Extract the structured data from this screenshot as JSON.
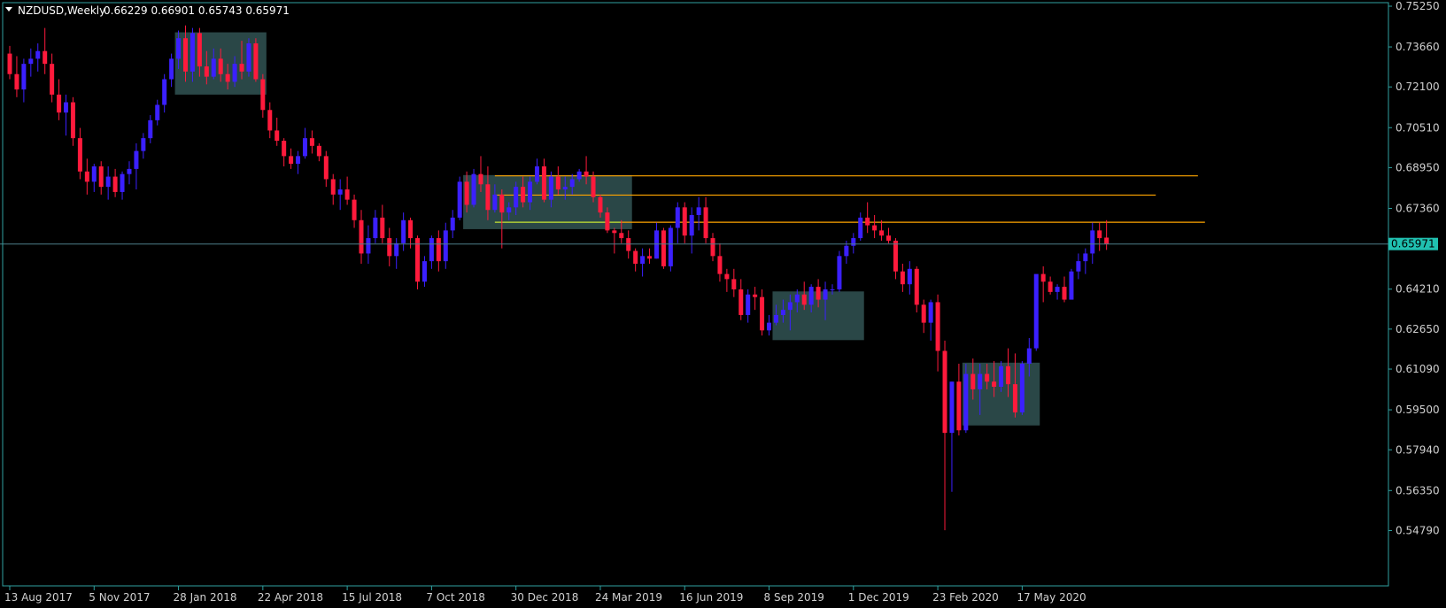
{
  "header": {
    "symbol_timeframe": "NZDUSD,Weekly",
    "ohlc": "0.66229 0.66901 0.65743 0.65971"
  },
  "colors": {
    "background": "#000000",
    "frame": "#2fa0a0",
    "bull": "#3b20ff",
    "bear": "#ff1a3c",
    "zone_fill": "#2f4f4f",
    "resistance": "#ffa500",
    "support": "#c8e632",
    "current_price_line": "#4d7f8a",
    "price_label_bg": "#20c0b0"
  },
  "chart_data": {
    "type": "candlestick",
    "title": "NZDUSD,Weekly",
    "ylim": [
      0.5415,
      0.7525
    ],
    "y_ticks": [
      "0.75250",
      "0.73660",
      "0.72100",
      "0.70510",
      "0.68950",
      "0.67360",
      "0.65971",
      "0.64210",
      "0.62650",
      "0.61090",
      "0.59500",
      "0.57940",
      "0.56350",
      "0.54790"
    ],
    "x_ticks": [
      "13 Aug 2017",
      "5 Nov 2017",
      "28 Jan 2018",
      "22 Apr 2018",
      "15 Jul 2018",
      "7 Oct 2018",
      "30 Dec 2018",
      "24 Mar 2019",
      "16 Jun 2019",
      "8 Sep 2019",
      "1 Dec 2019",
      "23 Feb 2020",
      "17 May 2020"
    ],
    "x_tick_index": [
      0,
      12,
      24,
      36,
      48,
      60,
      72,
      84,
      96,
      108,
      120,
      132,
      144
    ],
    "current_price": 0.65971,
    "current_price_label": "0.65971",
    "candles": [
      [
        0.734,
        0.737,
        0.724,
        0.726
      ],
      [
        0.726,
        0.733,
        0.717,
        0.72
      ],
      [
        0.72,
        0.732,
        0.715,
        0.73
      ],
      [
        0.73,
        0.736,
        0.725,
        0.732
      ],
      [
        0.732,
        0.738,
        0.727,
        0.735
      ],
      [
        0.735,
        0.744,
        0.726,
        0.73
      ],
      [
        0.73,
        0.734,
        0.715,
        0.718
      ],
      [
        0.718,
        0.724,
        0.708,
        0.711
      ],
      [
        0.711,
        0.718,
        0.702,
        0.715
      ],
      [
        0.715,
        0.717,
        0.698,
        0.701
      ],
      [
        0.701,
        0.705,
        0.685,
        0.688
      ],
      [
        0.688,
        0.693,
        0.679,
        0.684
      ],
      [
        0.684,
        0.691,
        0.68,
        0.69
      ],
      [
        0.69,
        0.692,
        0.679,
        0.682
      ],
      [
        0.682,
        0.69,
        0.677,
        0.686
      ],
      [
        0.686,
        0.689,
        0.678,
        0.68
      ],
      [
        0.68,
        0.688,
        0.677,
        0.687
      ],
      [
        0.687,
        0.692,
        0.683,
        0.689
      ],
      [
        0.689,
        0.699,
        0.681,
        0.696
      ],
      [
        0.696,
        0.703,
        0.693,
        0.701
      ],
      [
        0.701,
        0.71,
        0.699,
        0.708
      ],
      [
        0.708,
        0.716,
        0.706,
        0.714
      ],
      [
        0.714,
        0.726,
        0.711,
        0.724
      ],
      [
        0.724,
        0.734,
        0.721,
        0.732
      ],
      [
        0.732,
        0.743,
        0.728,
        0.74
      ],
      [
        0.74,
        0.745,
        0.723,
        0.727
      ],
      [
        0.727,
        0.744,
        0.723,
        0.742
      ],
      [
        0.742,
        0.744,
        0.725,
        0.729
      ],
      [
        0.729,
        0.735,
        0.722,
        0.725
      ],
      [
        0.725,
        0.736,
        0.724,
        0.732
      ],
      [
        0.732,
        0.736,
        0.723,
        0.726
      ],
      [
        0.726,
        0.73,
        0.72,
        0.723
      ],
      [
        0.723,
        0.733,
        0.721,
        0.73
      ],
      [
        0.73,
        0.739,
        0.724,
        0.727
      ],
      [
        0.727,
        0.74,
        0.725,
        0.738
      ],
      [
        0.738,
        0.74,
        0.723,
        0.724
      ],
      [
        0.724,
        0.726,
        0.709,
        0.712
      ],
      [
        0.712,
        0.715,
        0.701,
        0.704
      ],
      [
        0.704,
        0.709,
        0.698,
        0.7
      ],
      [
        0.7,
        0.701,
        0.69,
        0.694
      ],
      [
        0.694,
        0.697,
        0.689,
        0.691
      ],
      [
        0.691,
        0.696,
        0.687,
        0.694
      ],
      [
        0.694,
        0.705,
        0.693,
        0.701
      ],
      [
        0.701,
        0.704,
        0.695,
        0.698
      ],
      [
        0.698,
        0.699,
        0.692,
        0.694
      ],
      [
        0.694,
        0.696,
        0.682,
        0.685
      ],
      [
        0.685,
        0.687,
        0.675,
        0.679
      ],
      [
        0.679,
        0.685,
        0.673,
        0.681
      ],
      [
        0.681,
        0.686,
        0.675,
        0.677
      ],
      [
        0.677,
        0.679,
        0.666,
        0.669
      ],
      [
        0.669,
        0.673,
        0.652,
        0.656
      ],
      [
        0.656,
        0.667,
        0.652,
        0.662
      ],
      [
        0.662,
        0.673,
        0.66,
        0.67
      ],
      [
        0.67,
        0.675,
        0.66,
        0.662
      ],
      [
        0.662,
        0.666,
        0.651,
        0.655
      ],
      [
        0.655,
        0.662,
        0.65,
        0.66
      ],
      [
        0.66,
        0.672,
        0.657,
        0.669
      ],
      [
        0.669,
        0.67,
        0.658,
        0.662
      ],
      [
        0.662,
        0.663,
        0.642,
        0.645
      ],
      [
        0.645,
        0.655,
        0.643,
        0.653
      ],
      [
        0.653,
        0.663,
        0.65,
        0.662
      ],
      [
        0.662,
        0.665,
        0.649,
        0.653
      ],
      [
        0.653,
        0.668,
        0.65,
        0.665
      ],
      [
        0.665,
        0.673,
        0.662,
        0.67
      ],
      [
        0.67,
        0.686,
        0.669,
        0.684
      ],
      [
        0.684,
        0.688,
        0.672,
        0.675
      ],
      [
        0.675,
        0.689,
        0.674,
        0.687
      ],
      [
        0.687,
        0.694,
        0.68,
        0.683
      ],
      [
        0.683,
        0.69,
        0.669,
        0.673
      ],
      [
        0.673,
        0.683,
        0.672,
        0.679
      ],
      [
        0.679,
        0.681,
        0.658,
        0.672
      ],
      [
        0.672,
        0.676,
        0.669,
        0.674
      ],
      [
        0.674,
        0.684,
        0.671,
        0.682
      ],
      [
        0.682,
        0.686,
        0.674,
        0.676
      ],
      [
        0.676,
        0.686,
        0.673,
        0.684
      ],
      [
        0.684,
        0.693,
        0.683,
        0.69
      ],
      [
        0.69,
        0.693,
        0.676,
        0.677
      ],
      [
        0.677,
        0.688,
        0.674,
        0.686
      ],
      [
        0.686,
        0.69,
        0.679,
        0.681
      ],
      [
        0.681,
        0.686,
        0.677,
        0.682
      ],
      [
        0.682,
        0.687,
        0.679,
        0.685
      ],
      [
        0.685,
        0.689,
        0.684,
        0.688
      ],
      [
        0.688,
        0.694,
        0.683,
        0.686
      ],
      [
        0.686,
        0.688,
        0.676,
        0.678
      ],
      [
        0.678,
        0.679,
        0.67,
        0.672
      ],
      [
        0.672,
        0.674,
        0.664,
        0.665
      ],
      [
        0.665,
        0.666,
        0.656,
        0.664
      ],
      [
        0.664,
        0.669,
        0.66,
        0.662
      ],
      [
        0.662,
        0.665,
        0.654,
        0.657
      ],
      [
        0.657,
        0.658,
        0.649,
        0.652
      ],
      [
        0.652,
        0.658,
        0.647,
        0.655
      ],
      [
        0.655,
        0.658,
        0.652,
        0.654
      ],
      [
        0.654,
        0.668,
        0.654,
        0.665
      ],
      [
        0.665,
        0.666,
        0.65,
        0.651
      ],
      [
        0.651,
        0.667,
        0.649,
        0.666
      ],
      [
        0.666,
        0.676,
        0.66,
        0.674
      ],
      [
        0.674,
        0.676,
        0.66,
        0.663
      ],
      [
        0.663,
        0.674,
        0.656,
        0.671
      ],
      [
        0.671,
        0.678,
        0.665,
        0.674
      ],
      [
        0.674,
        0.678,
        0.66,
        0.662
      ],
      [
        0.662,
        0.664,
        0.653,
        0.655
      ],
      [
        0.655,
        0.66,
        0.645,
        0.648
      ],
      [
        0.648,
        0.65,
        0.641,
        0.646
      ],
      [
        0.646,
        0.65,
        0.639,
        0.642
      ],
      [
        0.642,
        0.646,
        0.63,
        0.632
      ],
      [
        0.632,
        0.642,
        0.629,
        0.64
      ],
      [
        0.64,
        0.643,
        0.634,
        0.639
      ],
      [
        0.639,
        0.642,
        0.624,
        0.626
      ],
      [
        0.626,
        0.632,
        0.624,
        0.629
      ],
      [
        0.629,
        0.636,
        0.628,
        0.632
      ],
      [
        0.632,
        0.638,
        0.629,
        0.634
      ],
      [
        0.634,
        0.64,
        0.626,
        0.637
      ],
      [
        0.637,
        0.642,
        0.633,
        0.64
      ],
      [
        0.64,
        0.645,
        0.634,
        0.636
      ],
      [
        0.636,
        0.644,
        0.633,
        0.643
      ],
      [
        0.643,
        0.646,
        0.635,
        0.638
      ],
      [
        0.638,
        0.645,
        0.63,
        0.642
      ],
      [
        0.642,
        0.644,
        0.64,
        0.642
      ],
      [
        0.642,
        0.657,
        0.641,
        0.655
      ],
      [
        0.655,
        0.661,
        0.652,
        0.659
      ],
      [
        0.659,
        0.664,
        0.656,
        0.662
      ],
      [
        0.662,
        0.672,
        0.661,
        0.67
      ],
      [
        0.67,
        0.676,
        0.664,
        0.667
      ],
      [
        0.667,
        0.671,
        0.662,
        0.665
      ],
      [
        0.665,
        0.669,
        0.661,
        0.663
      ],
      [
        0.663,
        0.666,
        0.66,
        0.661
      ],
      [
        0.661,
        0.662,
        0.646,
        0.649
      ],
      [
        0.649,
        0.652,
        0.641,
        0.644
      ],
      [
        0.644,
        0.653,
        0.64,
        0.65
      ],
      [
        0.65,
        0.651,
        0.633,
        0.636
      ],
      [
        0.636,
        0.638,
        0.625,
        0.629
      ],
      [
        0.629,
        0.638,
        0.622,
        0.637
      ],
      [
        0.637,
        0.64,
        0.61,
        0.618
      ],
      [
        0.618,
        0.622,
        0.548,
        0.586
      ],
      [
        0.586,
        0.606,
        0.563,
        0.606
      ],
      [
        0.606,
        0.613,
        0.585,
        0.587
      ],
      [
        0.587,
        0.613,
        0.586,
        0.609
      ],
      [
        0.609,
        0.615,
        0.599,
        0.603
      ],
      [
        0.603,
        0.613,
        0.593,
        0.609
      ],
      [
        0.609,
        0.613,
        0.603,
        0.606
      ],
      [
        0.606,
        0.614,
        0.6,
        0.604
      ],
      [
        0.604,
        0.614,
        0.602,
        0.612
      ],
      [
        0.612,
        0.619,
        0.6,
        0.605
      ],
      [
        0.605,
        0.617,
        0.592,
        0.594
      ],
      [
        0.594,
        0.614,
        0.593,
        0.613
      ],
      [
        0.613,
        0.623,
        0.608,
        0.619
      ],
      [
        0.619,
        0.645,
        0.618,
        0.648
      ],
      [
        0.648,
        0.651,
        0.637,
        0.645
      ],
      [
        0.645,
        0.647,
        0.64,
        0.641
      ],
      [
        0.641,
        0.644,
        0.638,
        0.643
      ],
      [
        0.643,
        0.647,
        0.637,
        0.638
      ],
      [
        0.638,
        0.65,
        0.638,
        0.649
      ],
      [
        0.649,
        0.656,
        0.646,
        0.653
      ],
      [
        0.653,
        0.658,
        0.648,
        0.656
      ],
      [
        0.656,
        0.668,
        0.652,
        0.665
      ],
      [
        0.665,
        0.668,
        0.657,
        0.662
      ],
      [
        0.6622,
        0.669,
        0.6574,
        0.6597
      ]
    ],
    "zones": [
      {
        "x_start": 24,
        "x_end": 36,
        "y_top": 0.7423,
        "y_bottom": 0.718
      },
      {
        "x_start": 65,
        "x_end": 88,
        "y_top": 0.6866,
        "y_bottom": 0.6655
      },
      {
        "x_start": 109,
        "x_end": 121,
        "y_top": 0.6412,
        "y_bottom": 0.6222
      },
      {
        "x_start": 136,
        "x_end": 146,
        "y_top": 0.6134,
        "y_bottom": 0.5889
      }
    ],
    "levels": [
      {
        "kind": "resistance",
        "price": 0.6863,
        "x_start": 69,
        "x_end": 169
      },
      {
        "kind": "resistance",
        "price": 0.6788,
        "x_start": 69,
        "x_end": 163
      },
      {
        "kind": "resistance",
        "price": 0.6682,
        "x_start": 87,
        "x_end": 170
      },
      {
        "kind": "support",
        "price": 0.6682,
        "x_start": 69,
        "x_end": 87
      }
    ]
  }
}
